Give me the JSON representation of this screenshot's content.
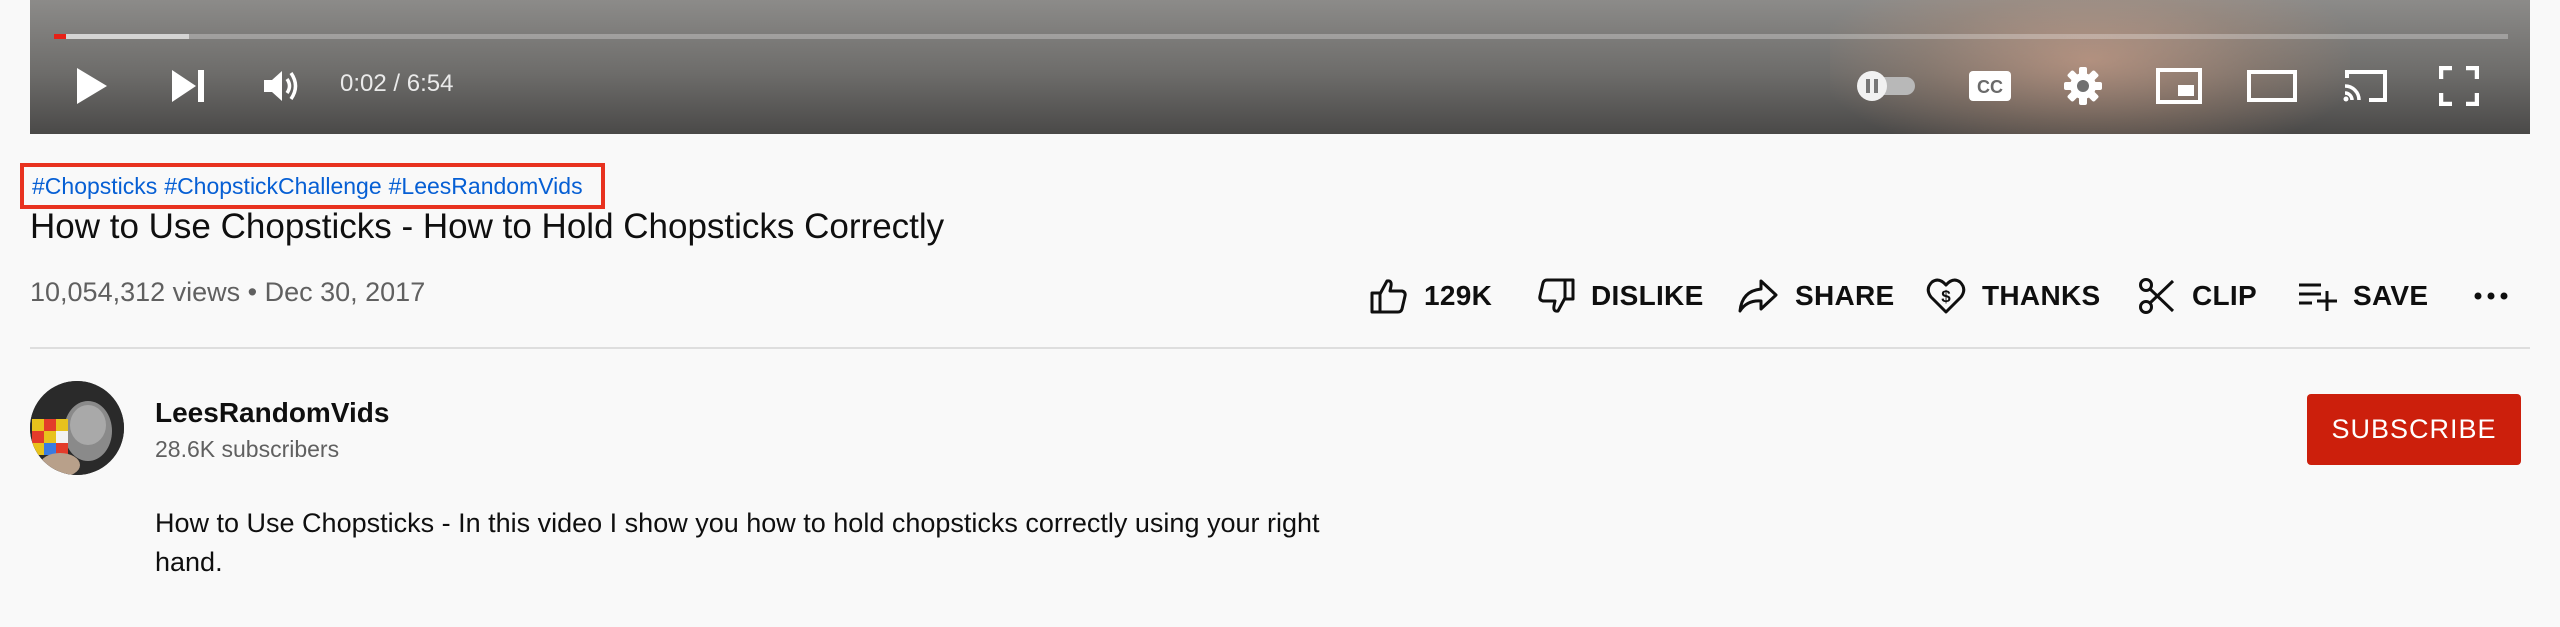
{
  "player": {
    "time_display": "0:02 / 6:54",
    "progress_played": 0.0049,
    "progress_loaded": 0.055,
    "controls": [
      "play-icon",
      "next-icon",
      "volume-icon",
      "autoplay-toggle-icon",
      "captions-icon",
      "settings-icon",
      "miniplayer-icon",
      "theater-mode-icon",
      "cast-icon",
      "fullscreen-icon"
    ],
    "captions_label": "CC"
  },
  "video": {
    "hashtags": [
      "#Chopsticks",
      "#ChopstickChallenge",
      "#LeesRandomVids"
    ],
    "title": "How to Use Chopsticks - How to Hold Chopsticks Correctly",
    "meta": "10,054,312 views • Dec 30, 2017"
  },
  "actions": {
    "like": "129K",
    "dislike": "DISLIKE",
    "share": "SHARE",
    "thanks": "THANKS",
    "clip": "CLIP",
    "save": "SAVE",
    "more_icon": "more-horizontal-icon"
  },
  "channel": {
    "name": "LeesRandomVids",
    "subscribers": "28.6K subscribers",
    "subscribe_label": "SUBSCRIBE",
    "subscribe_color": "#cc1f0c"
  },
  "description": "How to Use Chopsticks - In this video I show you how to hold chopsticks correctly using your right hand.",
  "colors": {
    "hashtag": "#065fd4",
    "highlight_border": "#e8321f",
    "progress_played": "#e62117"
  }
}
